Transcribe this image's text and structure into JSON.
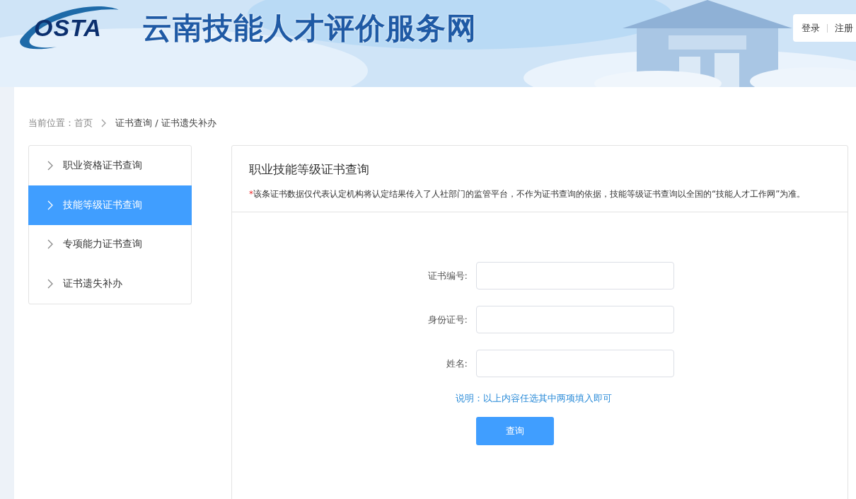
{
  "header": {
    "logo": "OSTA",
    "site_title": "云南技能人才评价服务网",
    "auth_links": [
      "登录",
      "注册"
    ]
  },
  "breadcrumb": {
    "label": "当前位置：",
    "items": [
      "首页",
      "证书查询 / 证书遗失补办"
    ]
  },
  "sidebar": {
    "items": [
      {
        "label": "职业资格证书查询",
        "selected": false
      },
      {
        "label": "技能等级证书查询",
        "selected": true
      },
      {
        "label": "专项能力证书查询",
        "selected": false
      },
      {
        "label": "证书遗失补办",
        "selected": false
      }
    ]
  },
  "panel": {
    "title": "职业技能等级证书查询",
    "notice_mark": "*",
    "notice": "该条证书数据仅代表认定机构将认定结果传入了人社部门的监管平台，不作为证书查询的依据，技能等级证书查询以全国的“技能人才工作网”为准。",
    "fields": [
      {
        "label": "证书编号:"
      },
      {
        "label": "身份证号:"
      },
      {
        "label": "姓名:"
      }
    ],
    "hint": "说明：以上内容任选其中两项填入即可",
    "submit": "查询"
  }
}
